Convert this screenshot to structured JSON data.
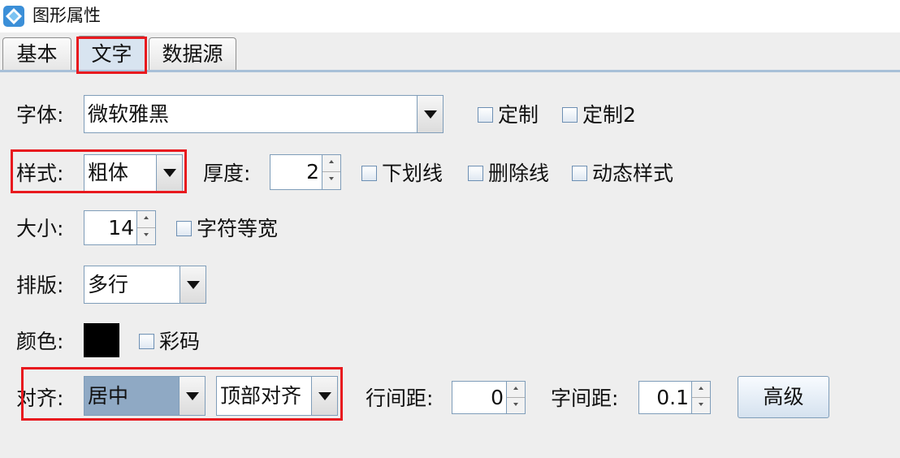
{
  "window": {
    "title": "图形属性",
    "icon": "app-diamond-icon"
  },
  "tabs": [
    {
      "label": "基本",
      "selected": false
    },
    {
      "label": "文字",
      "selected": true
    },
    {
      "label": "数据源",
      "selected": false
    }
  ],
  "font": {
    "label": "字体:",
    "value": "微软雅黑",
    "custom_label": "定制",
    "custom2_label": "定制2"
  },
  "style": {
    "label": "样式:",
    "value": "粗体",
    "thickness_label": "厚度:",
    "thickness_value": "2",
    "underline_label": "下划线",
    "strikethrough_label": "删除线",
    "dynamic_label": "动态样式"
  },
  "size": {
    "label": "大小:",
    "value": "14",
    "monospace_label": "字符等宽"
  },
  "layout": {
    "label": "排版:",
    "value": "多行"
  },
  "color": {
    "label": "颜色:",
    "swatch": "#000000",
    "colorcode_label": "彩码"
  },
  "align": {
    "label": "对齐:",
    "horizontal": "居中",
    "vertical": "顶部对齐",
    "line_spacing_label": "行间距:",
    "line_spacing_value": "0",
    "char_spacing_label": "字间距:",
    "char_spacing_value": "0.1",
    "advanced_label": "高级"
  },
  "colors": {
    "highlight": "#e8191e",
    "tab_selected": "#d8e4f0",
    "selection": "#8fa9c4"
  }
}
